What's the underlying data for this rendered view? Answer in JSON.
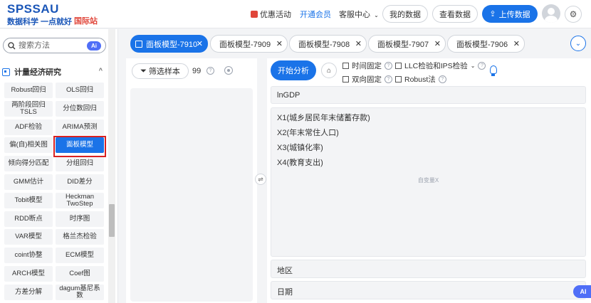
{
  "header": {
    "logo_main": "SPSSAU",
    "logo_sub": "数据科学 一点就好",
    "logo_intl": "国际站",
    "promo": "优惠活动",
    "vip": "开通会员",
    "service": "客服中心",
    "my_data": "我的数据",
    "view_data": "查看数据",
    "upload": "上传数据"
  },
  "sidebar": {
    "search_placeholder": "搜索方法",
    "ai_chip": "Ai",
    "category": "计量经济研究",
    "methods": [
      "Robust回归",
      "OLS回归",
      "两阶段回归\nTSLS",
      "分位数回归",
      "ADF检验",
      "ARIMA预测",
      "偏(自)相关图",
      "面板模型",
      "倾向得分匹配",
      "分组回归",
      "GMM估计",
      "DID差分",
      "Tobit模型",
      "Heckman\nTwoStep",
      "RDD断点",
      "时序图",
      "VAR模型",
      "格兰杰检验",
      "coint协整",
      "ECM模型",
      "ARCH模型",
      "Coef图",
      "方差分解",
      "dagum基尼系\n数"
    ],
    "active_method": "面板模型"
  },
  "tabs": [
    {
      "label": "面板模型-7910",
      "active": true
    },
    {
      "label": "面板模型-7909",
      "active": false
    },
    {
      "label": "面板模型-7908",
      "active": false
    },
    {
      "label": "面板模型-7907",
      "active": false
    },
    {
      "label": "面板模型-7906",
      "active": false
    }
  ],
  "var_panel": {
    "filter_label": "筛选样本",
    "count": "99"
  },
  "analysis": {
    "start_label": "开始分析",
    "options": {
      "time_fixed": "时间固定",
      "llc": "LLC检验和IPS检验",
      "two_way": "双向固定",
      "robust": "Robust法"
    },
    "y_var": "lnGDP",
    "x_vars": [
      "X1(城乡居民年末储蓄存款)",
      "X2(年末常住人口)",
      "X3(城镇化率)",
      "X4(教育支出)"
    ],
    "x_hint": "自变量X",
    "region_label": "地区",
    "date_label": "日期"
  },
  "ai_fab": "AI",
  "colors": {
    "primary": "#1a73e8",
    "brand": "#1a56b8",
    "accent_red": "#e0463a",
    "highlight_red": "#d92121"
  }
}
